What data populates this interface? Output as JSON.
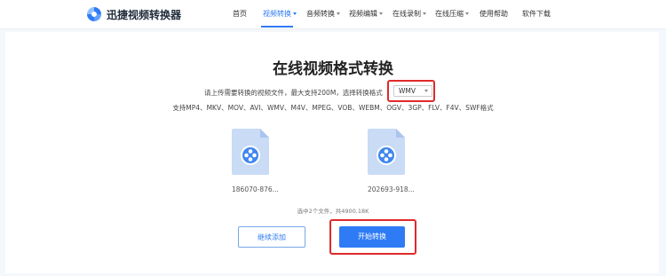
{
  "brand": {
    "name": "迅捷视频转换器"
  },
  "nav": [
    {
      "label": "首页",
      "dropdown": false,
      "active": false
    },
    {
      "label": "视频转换",
      "dropdown": true,
      "active": true
    },
    {
      "label": "音频转换",
      "dropdown": true,
      "active": false
    },
    {
      "label": "视频编辑",
      "dropdown": true,
      "active": false
    },
    {
      "label": "在线录制",
      "dropdown": true,
      "active": false
    },
    {
      "label": "在线压缩",
      "dropdown": true,
      "active": false
    },
    {
      "label": "使用帮助",
      "dropdown": false,
      "active": false
    },
    {
      "label": "软件下载",
      "dropdown": false,
      "active": false
    }
  ],
  "main": {
    "title": "在线视频格式转换",
    "hint": "请上传需要转换的视频文件，最大支持200M，选择转换格式",
    "format_selected": "WMV",
    "supported_formats": "支持MP4、MKV、MOV、AVI、WMV、M4V、MPEG、VOB、WEBM、OGV、3GP、FLV、F4V、SWF格式",
    "files": [
      {
        "name": "186070-876...",
        "icon": "video-file-icon"
      },
      {
        "name": "202693-918...",
        "icon": "video-file-icon"
      }
    ],
    "summary": "选中2个文件，共4900.18K",
    "continue_add_label": "继续添加",
    "start_label": "开始转换"
  },
  "colors": {
    "accent": "#2f7bf5",
    "highlight": "#e02a2a",
    "page_bg": "#f4f7fb"
  }
}
